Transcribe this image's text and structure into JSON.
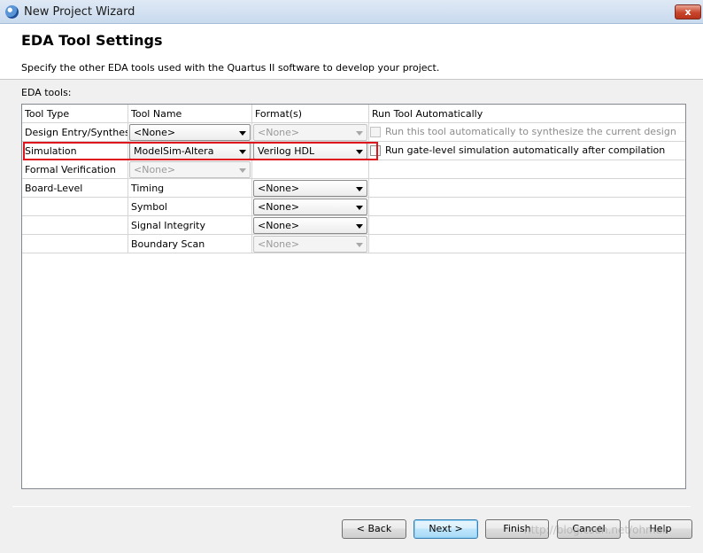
{
  "window": {
    "title": "New Project Wizard",
    "close_label": "x"
  },
  "page": {
    "title": "EDA Tool Settings",
    "subtitle": "Specify the other EDA tools used with the Quartus II software to develop your project.",
    "tools_label": "EDA tools:"
  },
  "table": {
    "headers": [
      "Tool Type",
      "Tool Name",
      "Format(s)",
      "Run Tool Automatically"
    ],
    "rows": {
      "design_entry": {
        "type": "Design Entry/Synthesis",
        "tool": "<None>",
        "format": "<None>",
        "run_label": "Run this tool automatically to synthesize the current design"
      },
      "simulation": {
        "type": "Simulation",
        "tool": "ModelSim-Altera",
        "format": "Verilog HDL",
        "run_label": "Run gate-level simulation automatically after compilation"
      },
      "formal": {
        "type": "Formal Verification",
        "tool": "<None>"
      },
      "timing": {
        "type": "Board-Level",
        "tool": "Timing",
        "format": "<None>"
      },
      "symbol": {
        "tool": "Symbol",
        "format": "<None>"
      },
      "signal": {
        "tool": "Signal Integrity",
        "format": "<None>"
      },
      "boundary": {
        "tool": "Boundary Scan",
        "format": "<None>"
      }
    }
  },
  "buttons": {
    "back": "< Back",
    "next": "Next >",
    "finish": "Finish",
    "cancel": "Cancel",
    "help": "Help"
  },
  "watermark": "http://blog.csdn.net/ohmal",
  "colors": {
    "highlight": "#e0141c",
    "title_bar": "#c9daee",
    "default_button": "#bee6fd"
  }
}
